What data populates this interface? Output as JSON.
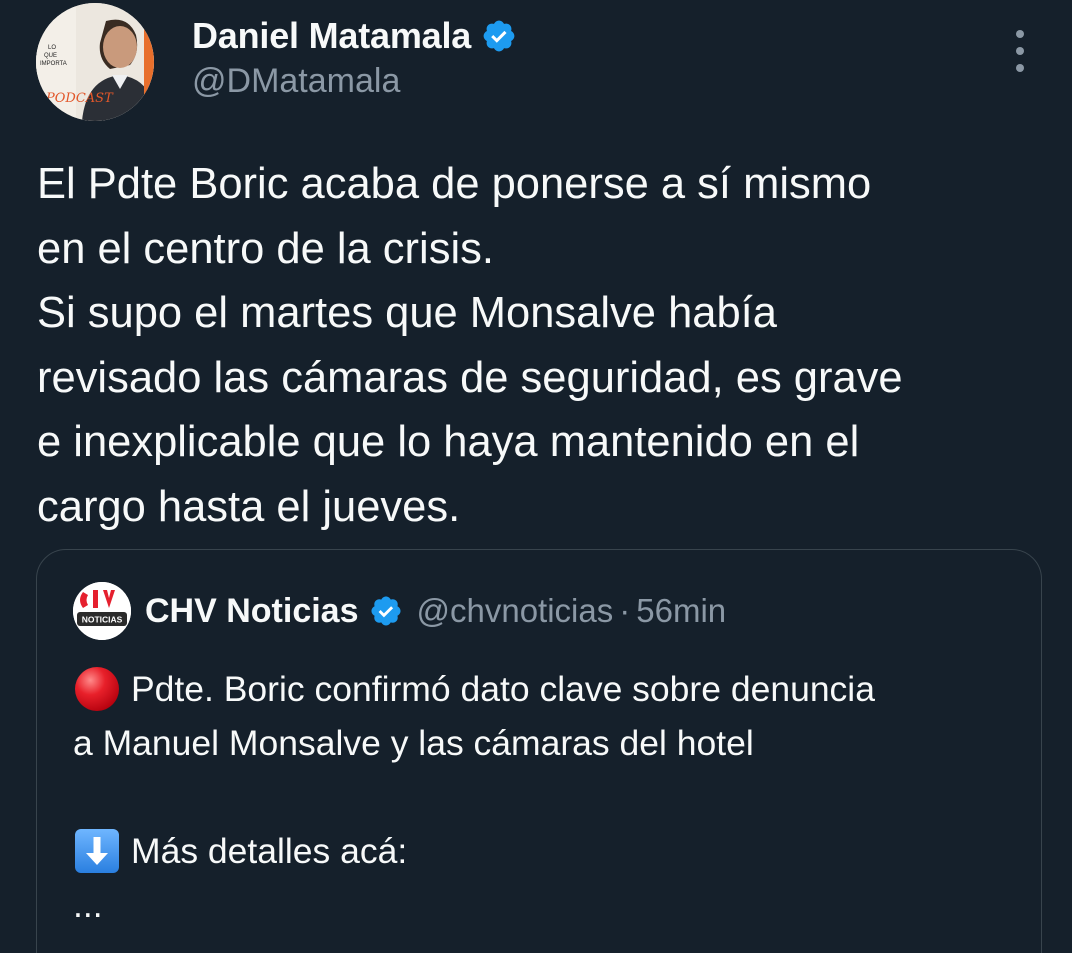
{
  "author": {
    "display_name": "Daniel Matamala",
    "handle": "@DMatamala",
    "verified": true,
    "avatar_badge_text": "PODCAST"
  },
  "tweet": {
    "lines": [
      "El Pdte Boric acaba de ponerse a sí mismo",
      "en el centro de la crisis.",
      "Si supo el martes que Monsalve había",
      "revisado las cámaras de seguridad, es grave",
      "e inexplicable que lo haya mantenido en el",
      "cargo hasta el jueves."
    ]
  },
  "quoted": {
    "display_name": "CHV Noticias",
    "handle": "@chvnoticias",
    "separator": "·",
    "time": "56min",
    "avatar_text": "NOTICIAS",
    "verified": true,
    "lines": [
      "Pdte. Boric confirmó dato clave sobre denuncia",
      "a Manuel Monsalve y las cámaras del hotel",
      "",
      "Más detalles acá:",
      "..."
    ]
  },
  "icons": {
    "verified": "verified-badge-icon",
    "more": "more-vertical-icon",
    "red_circle": "red-circle-emoji",
    "down_arrow": "down-arrow-emoji"
  },
  "colors": {
    "background": "#15202b",
    "text": "#f7f9f9",
    "secondary_text": "#8b98a5",
    "verified_blue": "#1d9bf0",
    "border": "#38444d"
  }
}
